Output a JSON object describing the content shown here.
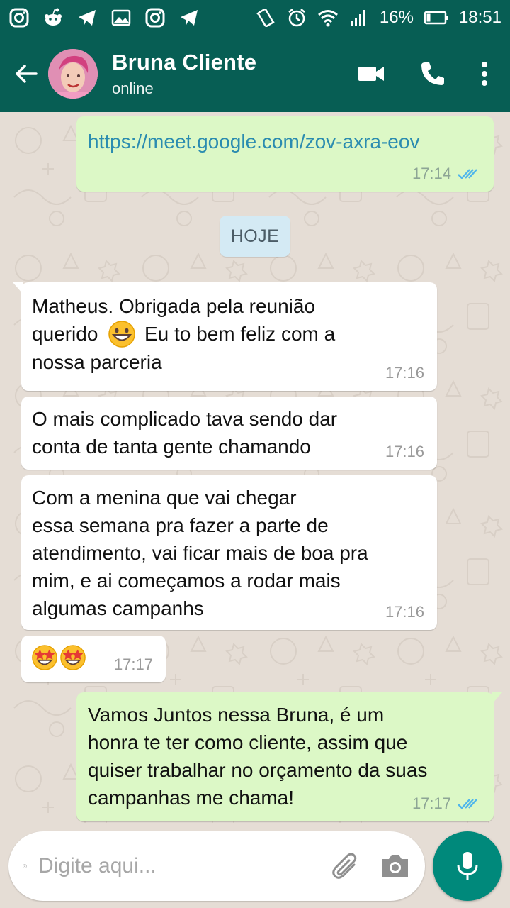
{
  "status_bar": {
    "battery": "16%",
    "time": "18:51",
    "icons": [
      "instagram-icon",
      "reddit-icon",
      "telegram-icon",
      "gallery-icon",
      "instagram-icon",
      "telegram-icon",
      "vibrate-icon",
      "alarm-icon",
      "wifi-icon",
      "signal-icon",
      "battery-icon"
    ]
  },
  "header": {
    "contact_name": "Bruna Cliente",
    "contact_status": "online",
    "icons": [
      "back-arrow-icon",
      "avatar",
      "video-call-icon",
      "phone-call-icon",
      "more-options-icon"
    ]
  },
  "messages": [
    {
      "direction": "outgoing",
      "text": "https://meet.google.com/zov-axra-eov",
      "time": "17:14",
      "status": "read"
    },
    {
      "direction": "incoming",
      "line1": "Matheus. Obrigada pela reunião",
      "line2a": "querido",
      "line2b": "Eu to bem feliz com a",
      "line3": "nossa parceria",
      "emoji": "grinning-face",
      "time": "17:16"
    },
    {
      "direction": "incoming",
      "line1": "O mais complicado tava sendo dar",
      "line2": "conta de tanta gente chamando",
      "time": "17:16"
    },
    {
      "direction": "incoming",
      "line1": "Com a menina que vai chegar",
      "line2": "essa semana pra fazer a parte de",
      "line3": "atendimento, vai ficar mais de boa pra",
      "line4": "mim, e ai começamos a rodar mais",
      "line5": "algumas campanhs",
      "time": "17:16"
    },
    {
      "direction": "incoming",
      "emoji": "star-struck x2",
      "time": "17:17"
    },
    {
      "direction": "outgoing",
      "line1": "Vamos Juntos nessa Bruna, é um",
      "line2": "honra te ter como cliente, assim que",
      "line3": "quiser trabalhar no orçamento da suas",
      "line4": "campanhas me chama!",
      "time": "17:17",
      "status": "read"
    }
  ],
  "date_divider": "HOJE",
  "composer": {
    "placeholder": "Digite aqui...",
    "icons": [
      "emoji-icon",
      "attach-icon",
      "camera-icon",
      "mic-icon"
    ]
  },
  "colors": {
    "header": "#075e54",
    "outgoing_bubble": "#dcf8c6",
    "incoming_bubble": "#ffffff",
    "link": "#2b8cb0",
    "read_ticks": "#4fb6ec",
    "mic_button": "#00897b",
    "date_chip": "#d4eaf4"
  }
}
